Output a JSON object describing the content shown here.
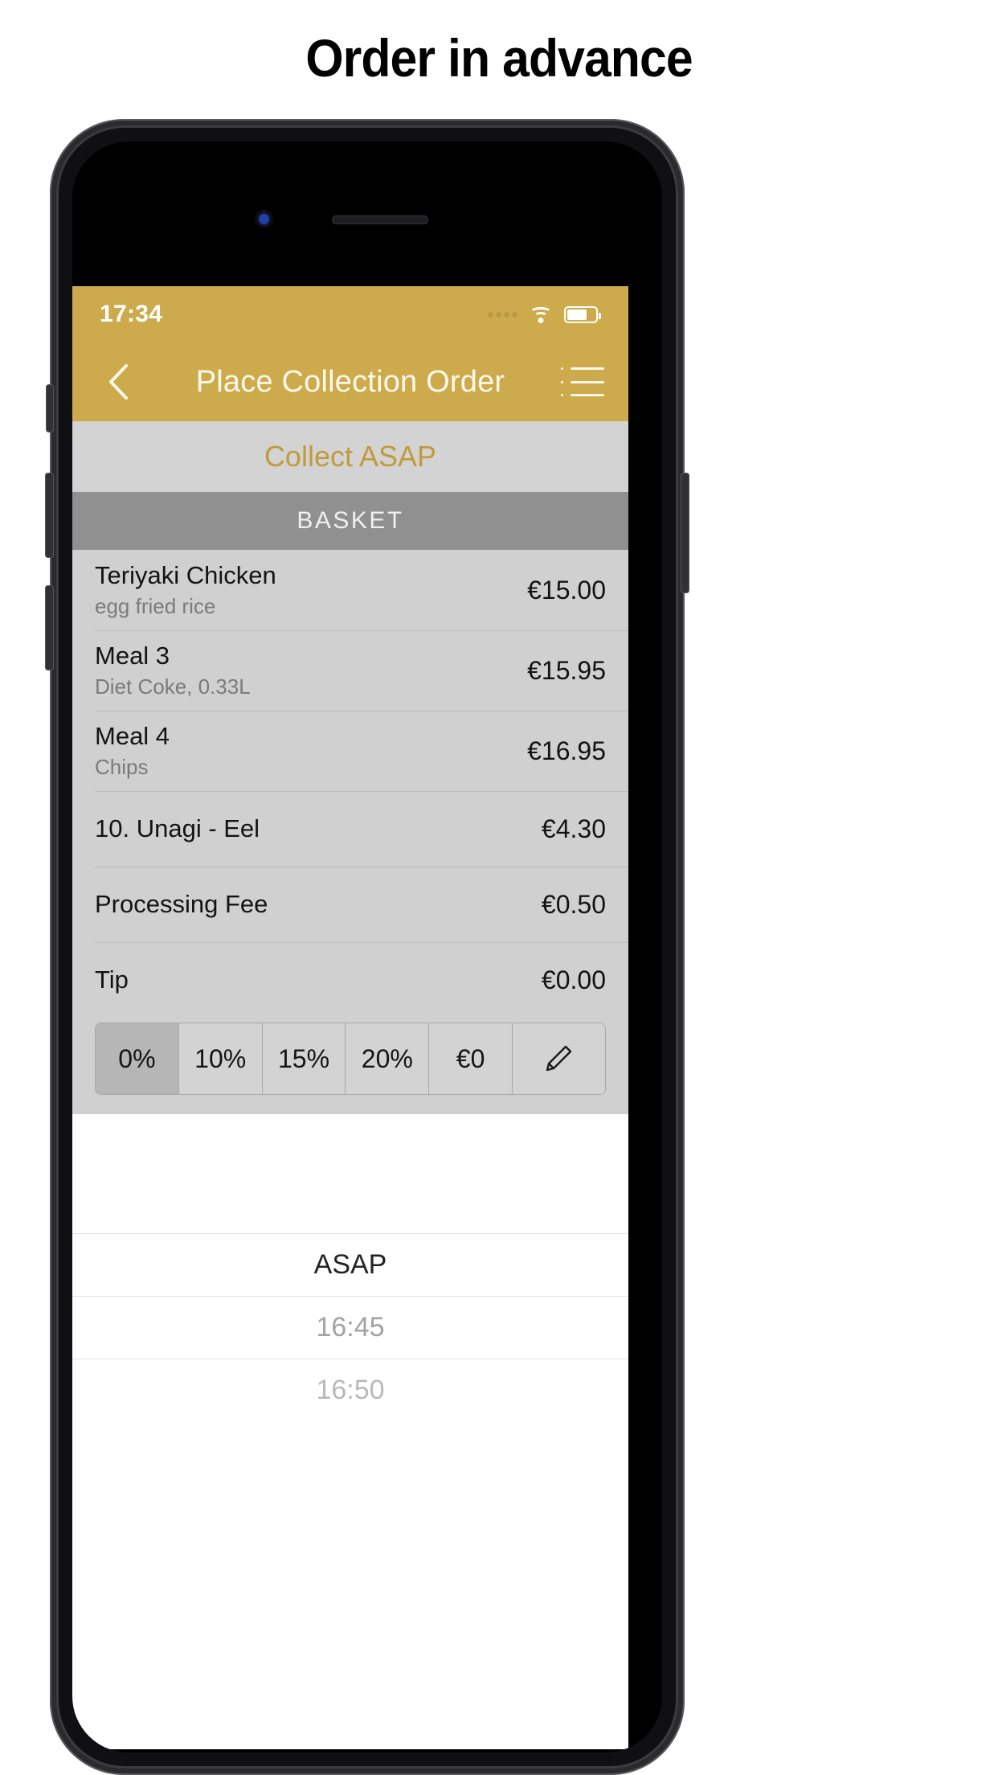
{
  "page": {
    "headline": "Order in advance"
  },
  "statusbar": {
    "time": "17:34",
    "signal_icon": "signal-dots-icon",
    "wifi_icon": "wifi-icon",
    "battery_icon": "battery-icon"
  },
  "navbar": {
    "back_icon": "chevron-left-icon",
    "title": "Place Collection Order",
    "menu_icon": "hamburger-menu-icon"
  },
  "collect_bar": {
    "label": "Collect ASAP"
  },
  "basket": {
    "header": "BASKET",
    "items": [
      {
        "name": "Teriyaki Chicken",
        "sub": "egg fried rice",
        "price": "€15.00"
      },
      {
        "name": "Meal 3",
        "sub": "Diet Coke, 0.33L",
        "price": "€15.95"
      },
      {
        "name": "Meal 4",
        "sub": "Chips",
        "price": "€16.95"
      },
      {
        "name": "10. Unagi - Eel",
        "sub": "",
        "price": "€4.30"
      },
      {
        "name": "Processing Fee",
        "sub": "",
        "price": "€0.50"
      },
      {
        "name": "Tip",
        "sub": "",
        "price": "€0.00"
      }
    ]
  },
  "tip_control": {
    "options": [
      {
        "label": "0%",
        "selected": true
      },
      {
        "label": "10%",
        "selected": false
      },
      {
        "label": "15%",
        "selected": false
      },
      {
        "label": "20%",
        "selected": false
      },
      {
        "label": "€0",
        "selected": false
      }
    ],
    "edit_icon": "pencil-icon"
  },
  "time_picker": {
    "rows": [
      {
        "label": "ASAP",
        "state": "current"
      },
      {
        "label": "16:45",
        "state": "dim"
      },
      {
        "label": "16:50",
        "state": "dimmer"
      }
    ]
  },
  "colors": {
    "brand_gold": "#cdab4c",
    "basket_bg": "#d0d0d0",
    "basket_header_bg": "#909090",
    "collect_bar_bg": "#d3d3d3",
    "collect_bar_text": "#c19b3b"
  }
}
